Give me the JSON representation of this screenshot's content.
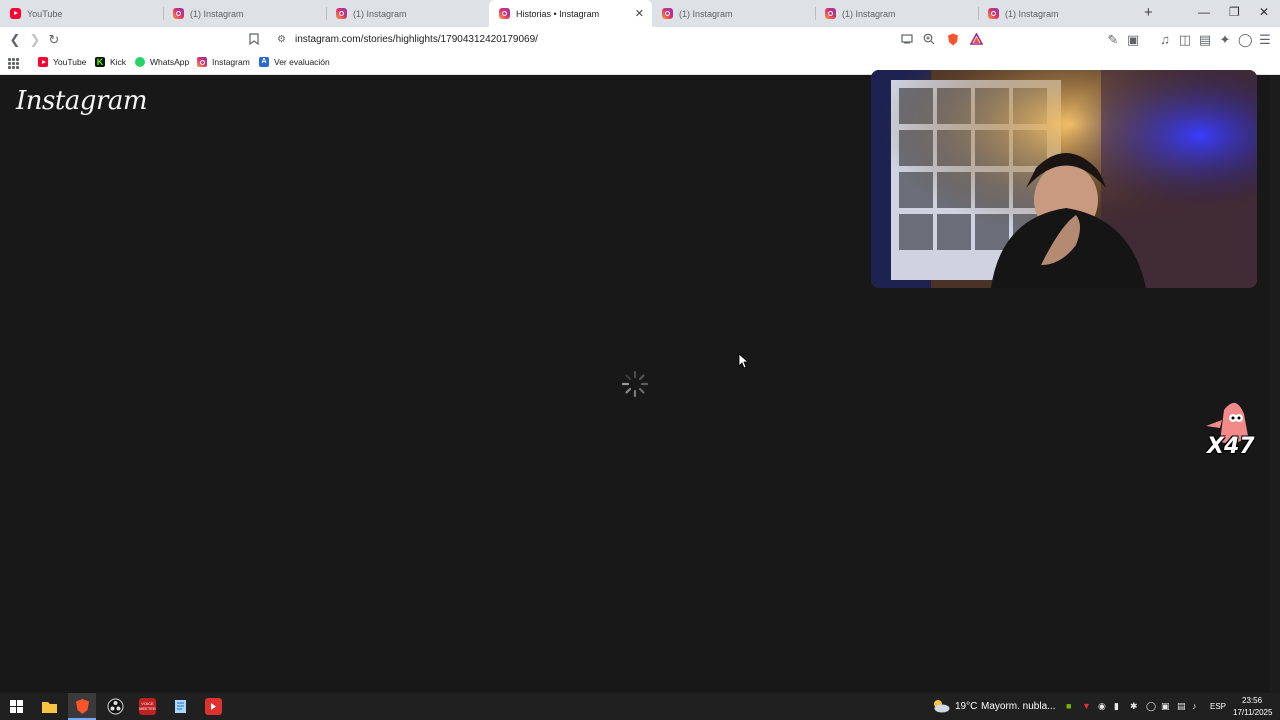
{
  "browser": {
    "tabs": [
      {
        "title": "YouTube",
        "favicon": "youtube-icon",
        "active": false
      },
      {
        "title": "(1) Instagram",
        "favicon": "instagram-icon",
        "active": false
      },
      {
        "title": "(1) Instagram",
        "favicon": "instagram-icon",
        "active": false
      },
      {
        "title": "Historias • Instagram",
        "favicon": "instagram-icon",
        "active": true
      },
      {
        "title": "(1) Instagram",
        "favicon": "instagram-icon",
        "active": false
      },
      {
        "title": "(1) Instagram",
        "favicon": "instagram-icon",
        "active": false
      },
      {
        "title": "(1) Instagram",
        "favicon": "instagram-icon",
        "active": false
      }
    ],
    "tab_close_glyph": "✕",
    "new_tab_glyph": "+",
    "url": "instagram.com/stories/highlights/17904312420179069/",
    "bookmarks": [
      {
        "label": "YouTube",
        "icon": "youtube-icon"
      },
      {
        "label": "Kick",
        "icon": "kick-icon",
        "glyph": "K"
      },
      {
        "label": "WhatsApp",
        "icon": "whatsapp-icon"
      },
      {
        "label": "Instagram",
        "icon": "instagram-icon"
      },
      {
        "label": "Ver evaluación",
        "icon": "ver-evaluacion-icon",
        "glyph": "A"
      }
    ]
  },
  "page": {
    "logo_text": "Instagram",
    "state": "loading",
    "overlay_counter": "X47"
  },
  "taskbar": {
    "weather_temp": "19°C",
    "weather_text": "Mayorm. nubla...",
    "language": "ESP",
    "time": "23:56",
    "date": "17/11/2025",
    "meeter_label": "VOICE\nMEETER"
  },
  "colors": {
    "page_bg": "#181818",
    "tabstrip_bg": "#dee1e6",
    "taskbar_bg": "#202020",
    "brave_orange": "#fb542b"
  }
}
